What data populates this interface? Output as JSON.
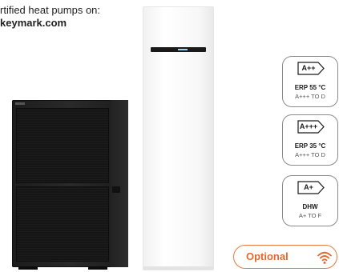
{
  "promo": {
    "line1": "rtified heat pumps on:",
    "line2": "keymark.com"
  },
  "ratings": [
    {
      "class": "A++",
      "label": "ERP 55 °C",
      "range": "A+++ TO D"
    },
    {
      "class": "A+++",
      "label": "ERP 35 °C",
      "range": "A+++ TO D"
    },
    {
      "class": "A+",
      "label": "DHW",
      "range": "A+ TO F"
    }
  ],
  "optional": {
    "label": "Optional",
    "icon": "wifi-icon"
  },
  "colors": {
    "accent_orange": "#e26a2c",
    "badge_border": "#8a8a8a",
    "outdoor_unit": "#1c1c1c",
    "indoor_unit": "#f7f7f7"
  }
}
